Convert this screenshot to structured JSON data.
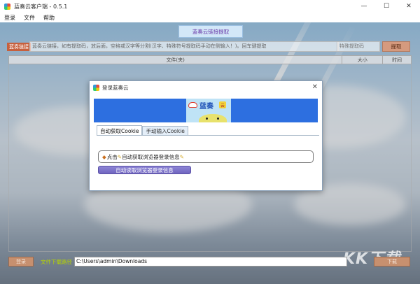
{
  "window": {
    "title": "蓝奏云客户端 - 0.5.1",
    "minimize": "—",
    "maximize": "☐",
    "close": "✕"
  },
  "menu": [
    "登录",
    "文件",
    "帮助"
  ],
  "main": {
    "tab_title": "蓝奏云链接提取",
    "link_label": "蓝奏链接",
    "link_placeholder": "蓝奏云链接，如有提取码，放后面，空格或汉字等分割(汉字、特殊符号提取码手动在侧输入！)。回车键提取",
    "code_placeholder": "特殊提取码",
    "fetch_button": "提取",
    "columns": [
      "文件(夹)",
      "大小",
      "时间"
    ]
  },
  "bottom": {
    "login_button": "登录",
    "path_label": "文件下载路径",
    "path_value": "C:\\Users\\admin\\Downloads",
    "right_button": "下载"
  },
  "watermark": "KK下载",
  "dialog": {
    "title": "登录蓝奏云",
    "close": "✕",
    "banner_text": "蓝奏",
    "banner_badge": "云",
    "tabs": [
      "自动获取Cookie",
      "手动输入Cookie"
    ],
    "info_text": "点击",
    "info_text2": "自动获取浏览器登录信息",
    "auto_button": "自动读取浏览器登录信息"
  },
  "colors": {
    "accent_purple": "#6a3aa8",
    "link_label_bg": "#c7603d",
    "fetch_btn_bg": "#d59a7e",
    "path_label": "#b6d400",
    "auto_btn": "#6f64bf",
    "banner_blue": "#2d6fe0"
  }
}
